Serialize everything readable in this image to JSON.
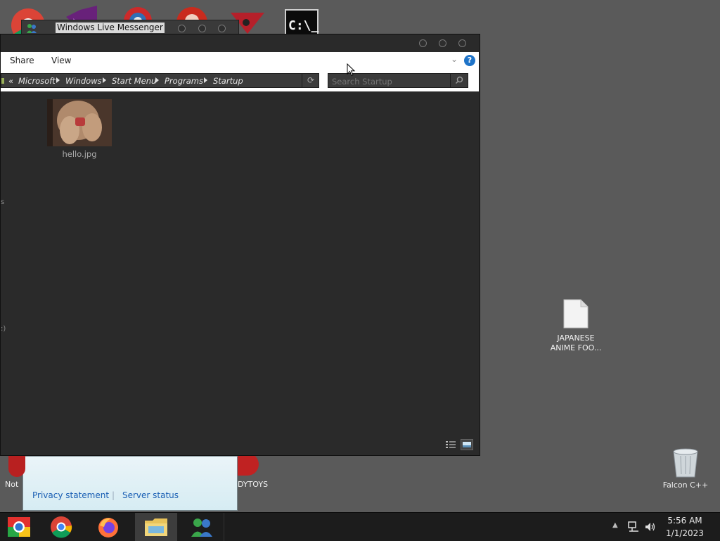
{
  "desktop": {
    "right_icons": [
      {
        "label_line1": "JAPANESE",
        "label_line2": "ANIME FOO...",
        "icon": "document-icon"
      },
      {
        "label": "Falcon C++",
        "icon": "recycle-bin-icon"
      }
    ],
    "partial_labels": {
      "left_bottom": "Not",
      "center_bottom": "DYTOYS"
    }
  },
  "messenger": {
    "title": "Windows Live Messenger",
    "links": [
      "Privacy statement",
      "Server status"
    ],
    "link_separator": "|"
  },
  "explorer": {
    "ribbon_tabs": [
      "Share",
      "View"
    ],
    "breadcrumb_prefix": "«",
    "breadcrumbs": [
      "Microsoft",
      "Windows",
      "Start Menu",
      "Programs",
      "Startup"
    ],
    "search_placeholder": "Search Startup",
    "files": [
      {
        "name": "hello.jpg"
      }
    ],
    "help_label": "?"
  },
  "taskbar": {
    "apps": [
      "chromium-icon",
      "chrome-icon",
      "firefox-icon",
      "file-explorer-icon",
      "messenger-icon"
    ],
    "clock": {
      "time": "5:56 AM",
      "date": "1/1/2023"
    }
  },
  "colors": {
    "accent": "#1a5fb4",
    "window_bg": "#2a2a2a",
    "desktop_bg": "#5a5a5a"
  }
}
